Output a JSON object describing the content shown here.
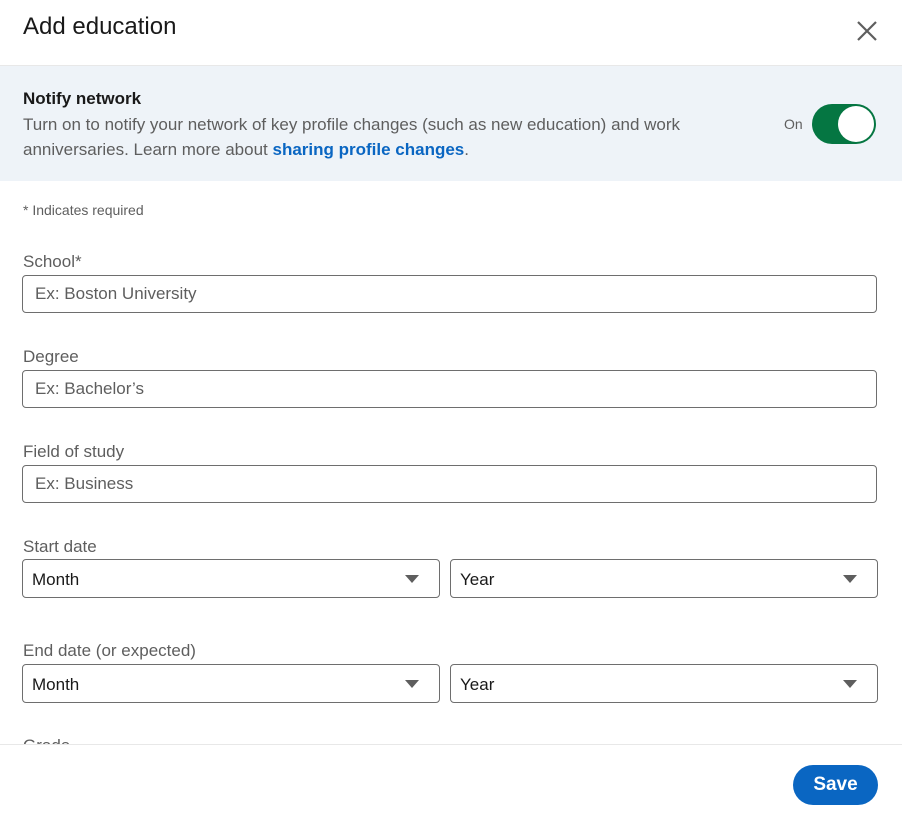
{
  "header": {
    "title": "Add education",
    "close_icon": "close-icon"
  },
  "notify": {
    "title": "Notify network",
    "description": "Turn on to notify your network of key profile changes (such as new education) and work anniversaries. Learn more about ",
    "link_text": "sharing profile changes",
    "description_end": ".",
    "toggle_label": "On",
    "toggle_on": true
  },
  "form": {
    "required_note": "* Indicates required",
    "school": {
      "label": "School*",
      "placeholder": "Ex: Boston University",
      "value": ""
    },
    "degree": {
      "label": "Degree",
      "placeholder": "Ex: Bachelor’s",
      "value": ""
    },
    "field_of_study": {
      "label": "Field of study",
      "placeholder": "Ex: Business",
      "value": ""
    },
    "start_date": {
      "label": "Start date",
      "month": "Month",
      "year": "Year"
    },
    "end_date": {
      "label": "End date (or expected)",
      "month": "Month",
      "year": "Year"
    },
    "grade": {
      "label": "Grade"
    }
  },
  "footer": {
    "save_label": "Save"
  },
  "colors": {
    "accent": "#0a66c2",
    "toggle_on": "#057642",
    "banner_bg": "#eef3f8"
  }
}
